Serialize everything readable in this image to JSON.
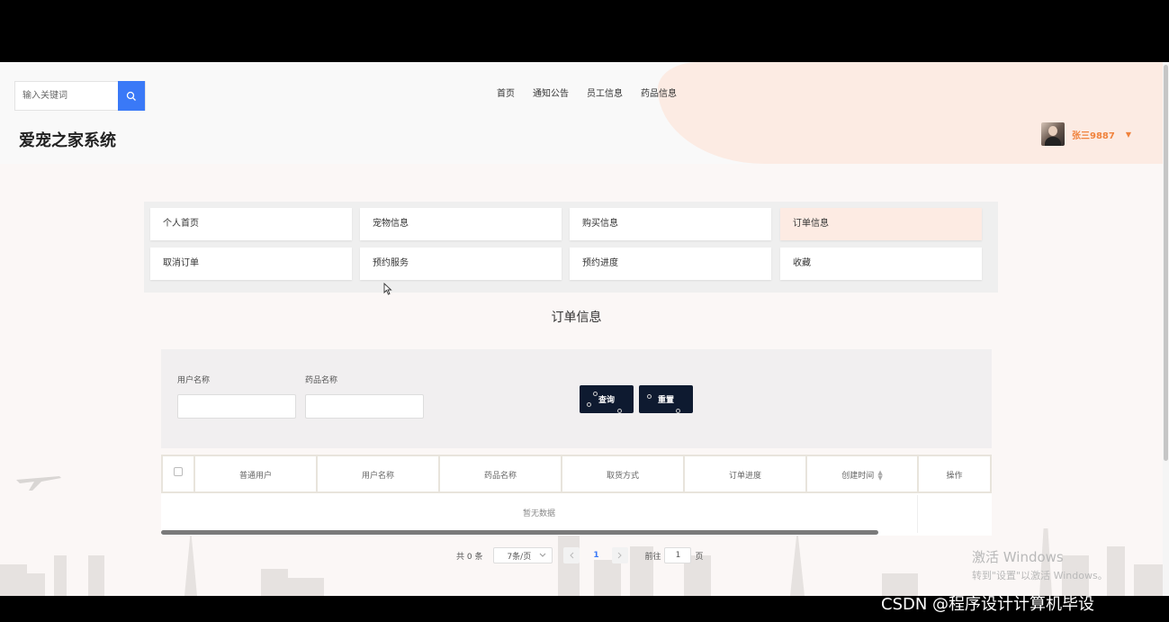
{
  "site": {
    "title": "爱宠之家系统"
  },
  "search": {
    "placeholder": "输入关键词",
    "icon": "search-icon"
  },
  "nav": [
    "首页",
    "通知公告",
    "员工信息",
    "药品信息"
  ],
  "user": {
    "name": "张三9887",
    "caret": "▼"
  },
  "menu": [
    {
      "label": "个人首页",
      "active": false
    },
    {
      "label": "宠物信息",
      "active": false
    },
    {
      "label": "购买信息",
      "active": false
    },
    {
      "label": "订单信息",
      "active": true
    },
    {
      "label": "取消订单",
      "active": false
    },
    {
      "label": "预约服务",
      "active": false
    },
    {
      "label": "预约进度",
      "active": false
    },
    {
      "label": "收藏",
      "active": false
    }
  ],
  "section_title": "订单信息",
  "filter": {
    "user_label": "用户名称",
    "drug_label": "药品名称",
    "query_button": "查询",
    "reset_button": "重置"
  },
  "table": {
    "columns": [
      "普通用户",
      "用户名称",
      "药品名称",
      "取货方式",
      "订单进度",
      "创建时间",
      "操作"
    ],
    "empty_text": "暂无数据"
  },
  "pager": {
    "total": "共 0 条",
    "page_size": "7条/页",
    "current_page": "1",
    "goto_label": "前往",
    "goto_value": "1",
    "goto_unit": "页"
  },
  "os": {
    "activate_line1": "激活 Windows",
    "activate_line2": "转到\"设置\"以激活 Windows。"
  },
  "watermark": "CSDN @程序设计计算机毕设",
  "colors": {
    "accent": "#3a79f7",
    "user": "#f0823c",
    "active_menu": "#fdebe3",
    "dark_button": "#0e1a30"
  }
}
